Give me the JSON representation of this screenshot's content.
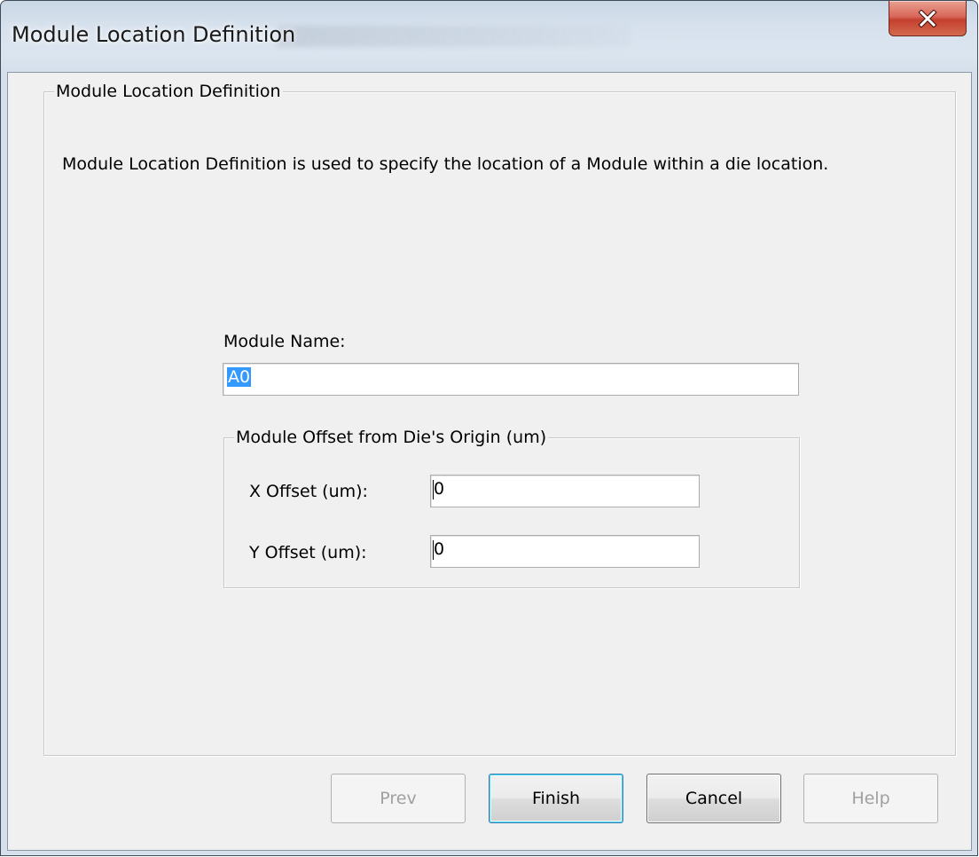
{
  "window": {
    "title": "Module Location Definition",
    "close_glyph": "x"
  },
  "group": {
    "legend": "Module Location Definition",
    "description": "Module Location Definition is used to specify the location of a Module within a die location."
  },
  "module_name": {
    "label": "Module Name:",
    "value": "A0"
  },
  "offset_group": {
    "legend": "Module Offset from Die's Origin (um)",
    "x_label": "X Offset (um):",
    "x_value": "0",
    "y_label": "Y Offset (um):",
    "y_value": "0"
  },
  "buttons": {
    "prev": "Prev",
    "finish": "Finish",
    "cancel": "Cancel",
    "help": "Help"
  },
  "icons": {
    "close": "close-icon"
  }
}
